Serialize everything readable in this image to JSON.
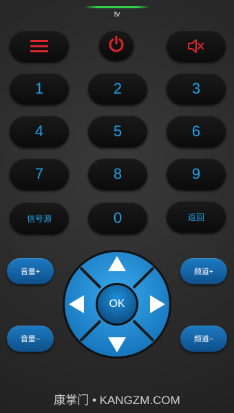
{
  "header": {
    "title": "tv"
  },
  "colors": {
    "accent": "#1ea2ec",
    "danger": "#e0262b",
    "dpad": "#1f8fd6",
    "indicator": "#31d04a"
  },
  "top_row": {
    "menu_icon": "menu-icon",
    "power_icon": "power-icon",
    "mute_icon": "mute-icon"
  },
  "keypad": {
    "keys": [
      "1",
      "2",
      "3",
      "4",
      "5",
      "6",
      "7",
      "8",
      "9"
    ],
    "signal_source": "信号源",
    "zero": "0",
    "back": "返回"
  },
  "side_buttons": {
    "volume_up": "音量+",
    "volume_down": "音量−",
    "channel_up": "频道+",
    "channel_down": "频道−"
  },
  "dpad": {
    "ok": "OK"
  },
  "footer": {
    "watermark": "康掌门 • KANGZM.COM"
  }
}
